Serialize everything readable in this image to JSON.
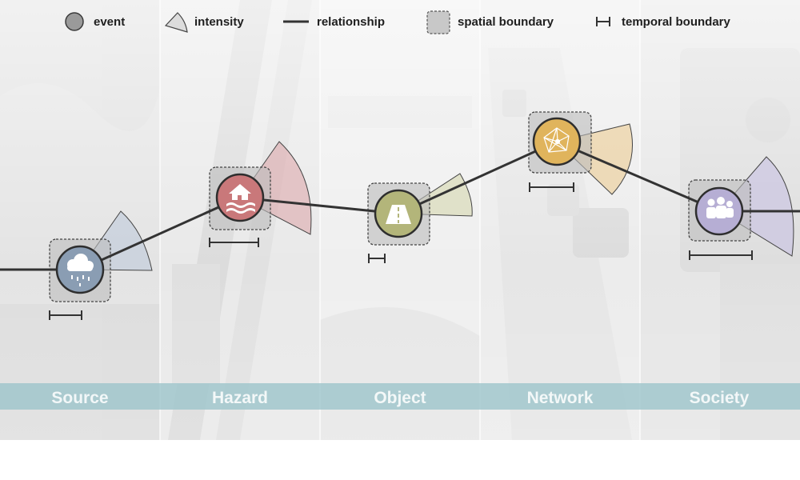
{
  "legend": {
    "event": "event",
    "intensity": "intensity",
    "relationship": "relationship",
    "spatial_boundary": "spatial boundary",
    "temporal_boundary": "temporal boundary"
  },
  "stages": [
    {
      "label": "Source",
      "icon": "rain-cloud-icon",
      "color": "#8a9db3"
    },
    {
      "label": "Hazard",
      "icon": "flooded-house-icon",
      "color": "#c9787a"
    },
    {
      "label": "Object",
      "icon": "road-icon",
      "color": "#b3b57a"
    },
    {
      "label": "Network",
      "icon": "network-icon",
      "color": "#e0b45c"
    },
    {
      "label": "Society",
      "icon": "people-icon",
      "color": "#b6aed4"
    }
  ],
  "colors": {
    "band": "#9cc4ca",
    "relationship_line": "#333333",
    "event_legend": "#9a9a9a",
    "boundary_fill": "#c8c8c8"
  }
}
